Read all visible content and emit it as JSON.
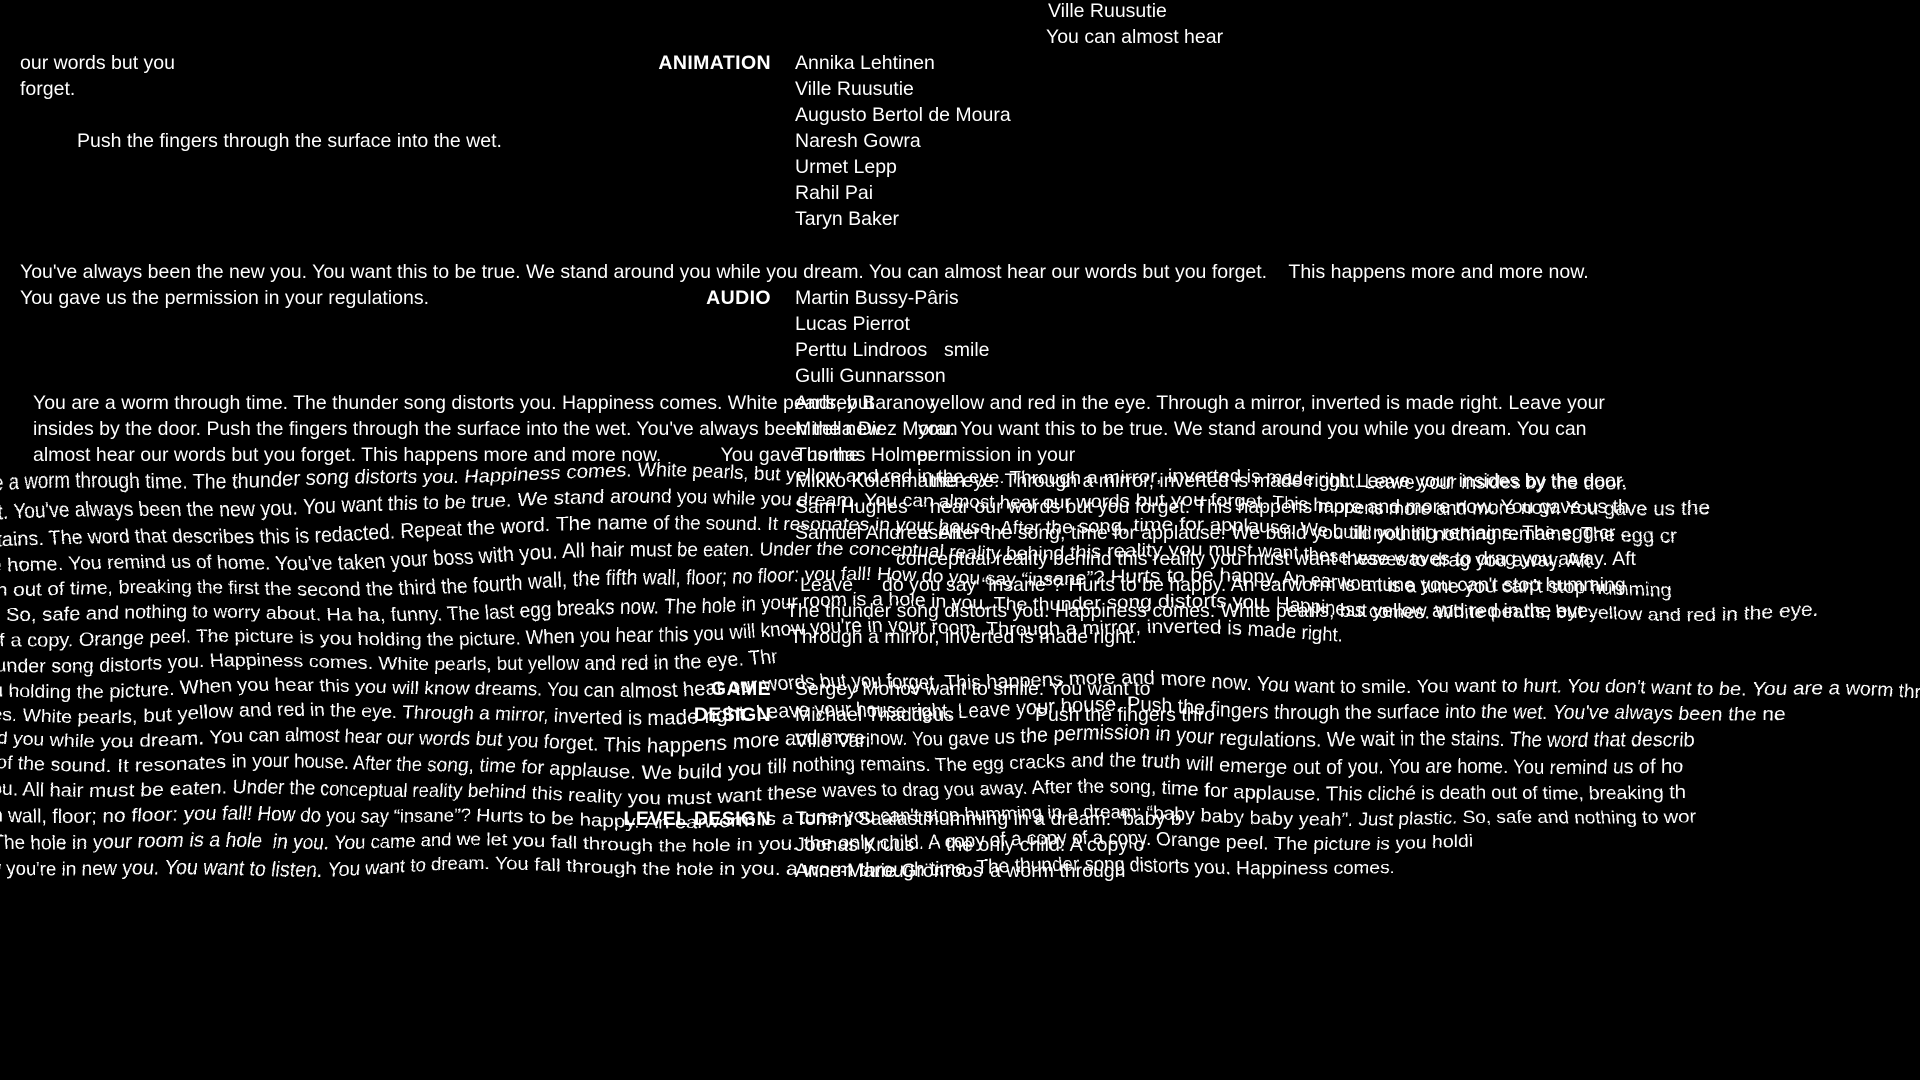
{
  "meta": {
    "background_color": "#000000",
    "text_color": "#ffffff",
    "screen": "game-credits-roll"
  },
  "narration": {
    "top_left_1": "our words but you",
    "top_left_2": "forget.",
    "top_indent_1": "Push the fingers through the surface into the wet.",
    "top_center_1": "Ville Ruusutie",
    "top_center_2": "You can almost hear",
    "band_line_1": "You've always been the new you. You want this to be true. We stand around you while you dream. You can almost hear our words but you forget.    This happens more and more now.",
    "band_line_2": "You gave us the permission in your regulations.",
    "para_a_1": "You are a worm through time. The thunder song distorts you. Happiness comes. White pearls, but",
    "para_a_2": "insides by the door. Push the fingers through the surface into the wet. You've always been the new",
    "para_a_3": "almost hear our words but you forget. This happens more and more now.           You gave us the",
    "right_a_1": "yellow and red in the eye. Through a mirror, inverted is made right. Leave your",
    "right_a_2": "you. You want this to be true. We stand around you while you dream. You can",
    "right_a_3": "permission in your"
  },
  "swirl_lines": [
    "are a worm through time. The thunder song distorts you. Happiness comes. White pearls, but yellow and red in the eye. Through a mirror, inverted is made right. Leave your insides by the door.",
    "wet. You've always been the new you. You want this to be true. We stand around you while you dream. You can almost hear our words but you forget. This happens more and more now. You gave us the",
    "e stains. The word that describes this is redacted. Repeat the word. The name of the sound. It resonates in your house. After the song, time for applause. We build you till nothing remains. The egg cr",
    "are home. You remind us of home. You've taken your boss with you. All hair must be eaten. Under the conceptual reality behind this reality you must want these waves to drag you away. Aft",
    "eath out of time, breaking the first the second the third the fourth wall, the fifth wall, floor; no floor: you fall! How do you say “insane”? Hurts to be happy. An earworm is a tune you can't stop humming",
    "tic. So, safe and nothing to worry about. Ha ha, funny. The last egg breaks now. The hole in your room is a hole in you. The thunder song distorts you. Happiness comes. White pearls, but yellow and red in the eye.",
    "y of a copy. Orange peel. The picture is you holding the picture. When you hear this you will know you're in your room. Through a mirror, inverted is made right.",
    "thunder song distorts you. Happiness comes. White pearls, but yellow and red in the eye. Thr",
    "you holding the picture. When you hear this you will know dreams. You can almost hear our words but you forget. This happens more and more now. You want to smile. You want to hurt. You don't want to be. You are a worm through time.",
    "mes. White pearls, but yellow and red in the eye. Through a mirror, inverted is made right. Leave your house right. Leave your house. Push the fingers through the surface into the wet. You've always been the ne",
    "und you while you dream. You can almost hear our words but you forget. This happens more and more now. You gave us the permission in your regulations. We wait in the stains. The word that describ",
    "ne of the sound. It resonates in your house. After the song, time for applause. We build you till nothing remains. The egg cracks and the truth will emerge out of you. You are home. You remind us of ho",
    "h you. All hair must be eaten. Under the conceptual reality behind this reality you must want these waves to drag you away. After the song, time for applause. This cliché is death out of time, breaking th",
    "fifth wall, floor; no floor: you fall! How do you say “insane”? Hurts to be happy. An earworm is a tune you can't stop humming in a dream: “baby baby baby yeah”. Just plastic. So, safe and nothing to wor",
    "w. The hole in your room is a hole  in you. You came and we let you fall through the hole in you. the only child. A copy of a copy of a copy. Orange peel. The picture is you holdi",
    "ow you're in new you. You want to listen. You want to dream. You fall through the hole in you. a worm through time. The thunder song distorts you. Happiness comes."
  ],
  "credits": [
    {
      "heading": "ANIMATION",
      "names": [
        "Annika Lehtinen",
        "Ville Ruusutie",
        "Augusto Bertol de Moura",
        "Naresh Gowra",
        "Urmet Lepp",
        "Rahil Pai",
        "Taryn Baker"
      ]
    },
    {
      "heading": "AUDIO",
      "names": [
        "Martin Bussy-Pâris",
        "Lucas Pierrot",
        "Perttu Lindroos",
        "Gulli Gunnarsson",
        "Andrey Baranov",
        "Mirella Diez Moran",
        "Thomas Holmer",
        "Mikko Kolehmainen",
        "Sam Hughes",
        "Samuel Andreasen"
      ]
    },
    {
      "heading": "GAME DESIGN",
      "names": [
        "Sergey Mohov",
        "Michael Thaddeus",
        "Ville Vari"
      ]
    },
    {
      "heading": "LEVEL DESIGN",
      "names": [
        "Tommi Saalasti",
        "Joonas Kruus",
        "Anne-Marie Grönroos"
      ]
    }
  ],
  "fragments": {
    "smile": "smile",
    "leave": "Leave",
    "yellow_red": "yellow and red in the eye.",
    "you_want": "you. You want this to be tr",
    "permission": "permission in your",
    "the_eye": "the eye. Through a mirror,",
    "hear_our": "hear our words but you f",
    "after_song": "e. After the song, time for",
    "conceptual": "conceptual reality behind this",
    "insane": "do you say “insane”? Hurts to",
    "want_smile": "want to smile. You want to",
    "push_fingers": "Push the fingers thro",
    "humming": "humming in a dream: “baby b",
    "only_child": "the only child. A copy o",
    "worm_through": "a worm through"
  },
  "right_block": {
    "l1": "yellow and red in the eye. Through a mirror, inverted is made right. Leave your",
    "l2": "you. You want this to be true. We stand around you while you dream. You can",
    "l3": "permission in your",
    "l4": "the eye. Through a mirror, inverted is made right. Leave your insides by the door.",
    "l5": "hear our words but you forget. This happens more and more now. You gave us th",
    "l6": "e. After the song, time for applause. We build you till nothing remains. The egg cr",
    "l7": "conceptual reality behind this reality you must want these waves to drag you away. Aft",
    "l8": "do you say “insane”? Hurts to be happy. An earworm is a tune you can't stop humming",
    "l9": "The thunder song distorts you. Happiness comes. White pearls, but yellow and red in the eye.",
    "l10": "Through a mirror, inverted is made right."
  }
}
